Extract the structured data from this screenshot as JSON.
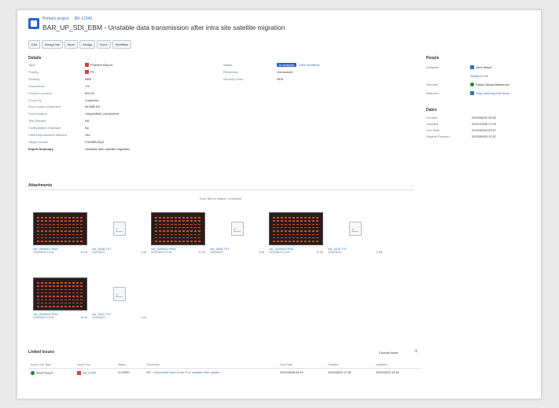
{
  "header": {
    "breadcrumbs": [
      "Primary project",
      "BK-12345"
    ],
    "title": "BAR_UP_SDI_EBM - Unstable data transmission after intra site satellite migration"
  },
  "toolbar": [
    "Edit",
    "Assign link",
    "More",
    "Assign",
    "Done",
    "Workflow"
  ],
  "details": {
    "heading": "Details",
    "left": [
      {
        "label": "Type",
        "value": "Problem Report",
        "icon": "bug-icon"
      },
      {
        "label": "Priority",
        "value": "P1",
        "icon": "priority-icon"
      },
      {
        "label": "Severity",
        "value": "B&R"
      },
      {
        "label": "Occurrence",
        "value": "1%"
      },
      {
        "label": "Found in product",
        "value": "BX123"
      },
      {
        "label": "Found by",
        "value": "Customer"
      },
      {
        "label": "Root cause component",
        "value": "IM  IMR  BX"
      },
      {
        "label": "Fault location",
        "value": "Unspecified_component"
      },
      {
        "label": "Test Needed",
        "value": "NA"
      },
      {
        "label": "Configuration Changed",
        "value": "No"
      },
      {
        "label": "Fault Reproduction Needed",
        "value": "Yes"
      },
      {
        "label": "Target version",
        "value": "FSA/BR25Q4"
      },
      {
        "label": "Expert Summary",
        "value": "Unstable after satellite migration"
      }
    ],
    "right": [
      {
        "label": "Status",
        "value": "In Analysis",
        "badge": true,
        "link": "View Workflow"
      },
      {
        "label": "Resolution",
        "value": "Unresolved"
      },
      {
        "label": "Security Level",
        "value": "NDS"
      }
    ]
  },
  "people": {
    "heading": "People",
    "rows": [
      {
        "label": "Assignee",
        "value": "Jane Mayer"
      },
      {
        "label": "",
        "value": "Assign to me"
      },
      {
        "label": "Reporter",
        "value": "Rupal Jasuid Blankenso"
      },
      {
        "label": "Watchers",
        "value": "Stop watching this issue"
      }
    ]
  },
  "dates": {
    "heading": "Dates",
    "rows": [
      {
        "label": "Created",
        "value": "2022/08/22 09:02"
      },
      {
        "label": "Updated",
        "value": "2022/11/08 17:09"
      },
      {
        "label": "Due Date",
        "value": "2022/09/03 09:37"
      },
      {
        "label": "Original Planned",
        "value": "2022/09/03 12:07"
      }
    ]
  },
  "attachments": {
    "heading": "Attachments",
    "drop_text": "Drop files to attach, or browse.",
    "items": [
      {
        "name": "Ver_0009001.PNG",
        "date": "2022/08/22 10:45",
        "size": "31 kB",
        "image": true
      },
      {
        "name": "Ver_0008.TXT",
        "date": "2022/08/22",
        "size": "4 kB",
        "image": false
      },
      {
        "name": "Ver_0009002.PNG",
        "date": "2022/08/22 10:45",
        "size": "32 kB",
        "image": true
      },
      {
        "name": "Ver_0009.TXT",
        "date": "2022/08/22",
        "size": "5 kB",
        "image": false
      },
      {
        "name": "Ver_0009003.PNG",
        "date": "2022/08/22 10:45",
        "size": "33 kB",
        "image": true
      },
      {
        "name": "Ver_0010.TXT",
        "date": "2022/08/22",
        "size": "6 kB",
        "image": false
      },
      {
        "name": "Ver_0009004.PNG",
        "date": "2022/08/22 10:45",
        "size": "30 kB",
        "image": true
      },
      {
        "name": "Ver_0011.TXT",
        "date": "2022/08/22",
        "size": "4 kB",
        "image": false
      }
    ]
  },
  "linked": {
    "heading": "Linked Issues",
    "filter": "Choose Issue",
    "columns": [
      "Issue Link Type",
      "Issue Key",
      "Status",
      "Summary",
      "Due Date",
      "Created",
      "Updated"
    ],
    "rows": [
      {
        "type": "Issue Report",
        "key": "BK-12345",
        "status": "CLOSED",
        "summary": "BR - Unavailable data at site P or unstable after update",
        "due": "2022/08/06 09:49",
        "created": "2022/08/22 17:06",
        "updated": "2022/08/22 12:34"
      }
    ]
  }
}
